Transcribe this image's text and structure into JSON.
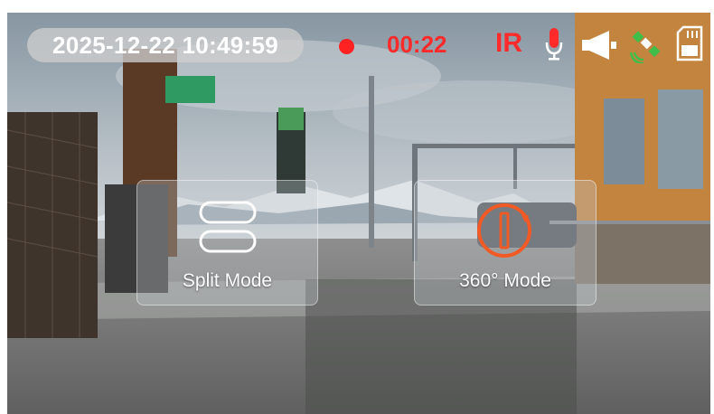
{
  "status_bar": {
    "timestamp": "2025-12-22 10:49:59",
    "recording_time": "00:22",
    "ir_label": "IR",
    "accent_color": "#ff2a2a",
    "icons": [
      "record-indicator-icon",
      "microphone-icon",
      "speaker-icon",
      "gps-satellite-icon",
      "sd-card-icon"
    ]
  },
  "modes": {
    "split_label": "Split Mode",
    "rotate_label": "360° Mode",
    "split_icon": "split-view-icon",
    "rotate_icon": "360-rotate-icon",
    "rotate_icon_color": "#f15a24"
  }
}
